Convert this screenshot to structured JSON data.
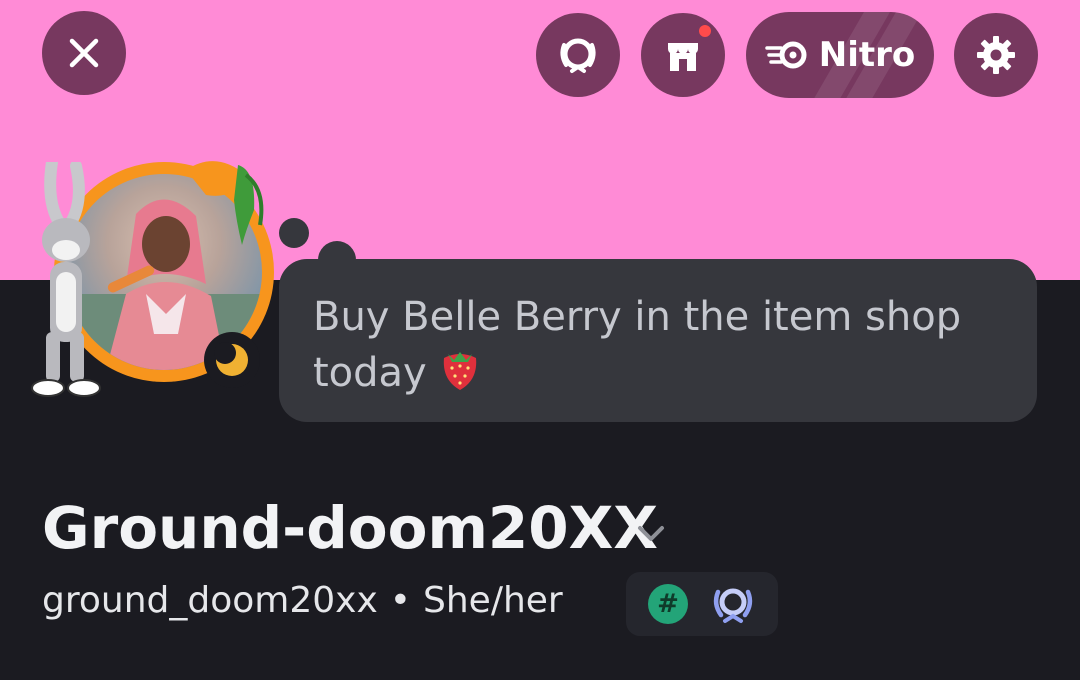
{
  "banner": {
    "color": "#ff8bd6"
  },
  "header": {
    "close_icon": "close-icon",
    "quests_icon": "wreath-icon",
    "shop_icon": "shop-icon",
    "nitro_label": "Nitro",
    "settings_icon": "gear-icon"
  },
  "profile": {
    "status_bubble": "Buy Belle Berry in the item shop today",
    "status_emoji": "strawberry-emoji",
    "display_name": "Ground-doom20XX",
    "username": "ground_doom20xx",
    "separator": "•",
    "pronouns": "She/her",
    "badges": [
      "hashtag-badge",
      "wreath-badge"
    ],
    "status_icon": "idle-moon-icon"
  },
  "colors": {
    "button_bg": "#77385f",
    "panel_bg": "#1b1b21",
    "bubble_bg": "#36373d",
    "avatar_ring": "#f7951d"
  }
}
